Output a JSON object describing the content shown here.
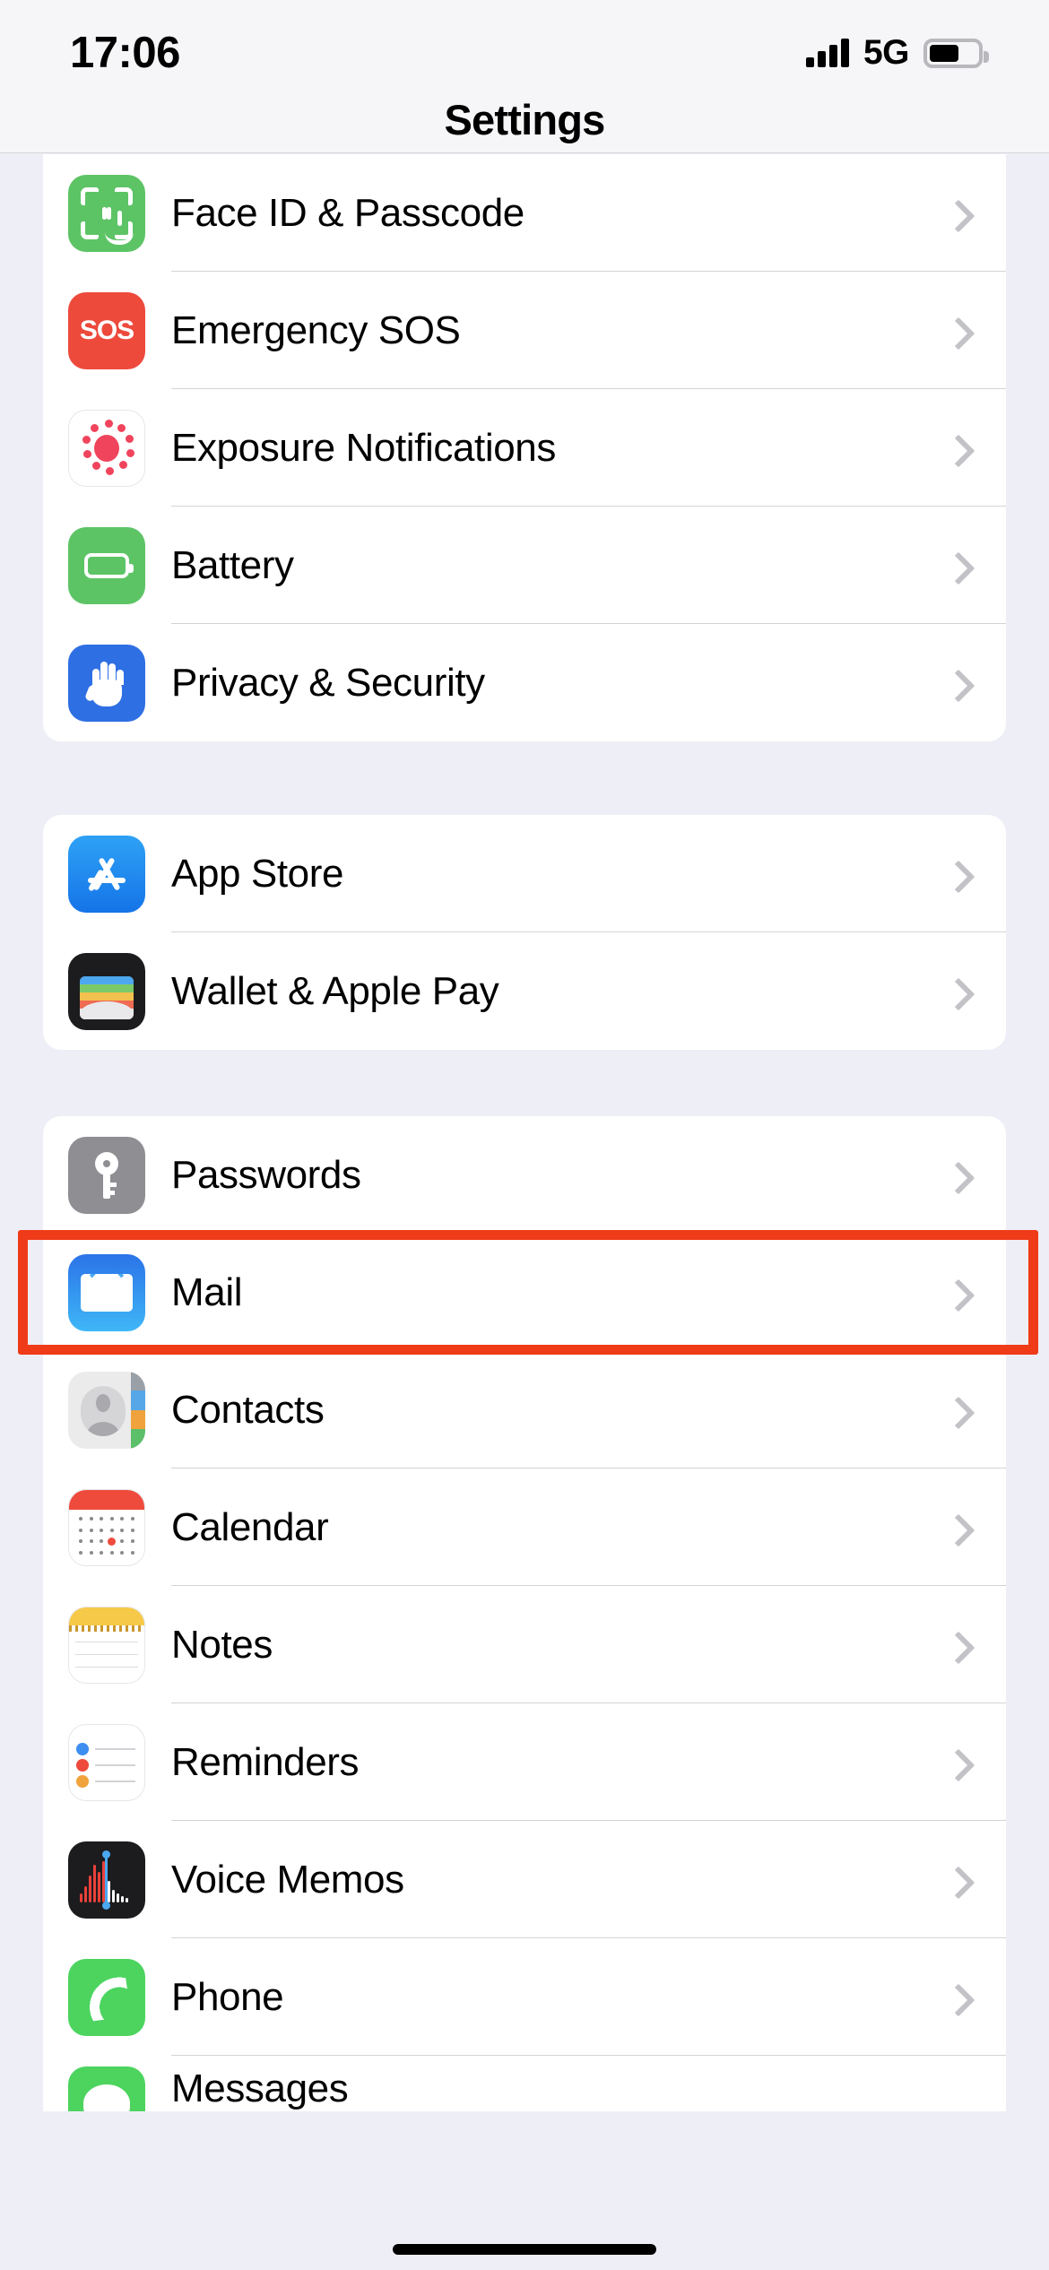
{
  "status_bar": {
    "time": "17:06",
    "network": "5G",
    "signal_icon": "signal-bars-icon",
    "battery_icon": "battery-icon",
    "battery_level_percent": 62
  },
  "nav": {
    "title": "Settings"
  },
  "theme": {
    "background": "#eeeef6",
    "card_background": "#ffffff",
    "separator": "#d4d4d8",
    "chevron": "#c2c2c7",
    "highlight": "#ef3b18",
    "label_text": "#000000"
  },
  "groups": [
    {
      "name": "security-group",
      "rows": [
        {
          "label": "Face ID & Passcode",
          "icon": "faceid-icon",
          "chevron": true
        },
        {
          "label": "Emergency SOS",
          "icon": "sos-icon",
          "chevron": true,
          "icon_text": "SOS"
        },
        {
          "label": "Exposure Notifications",
          "icon": "exposure-notifications-icon",
          "chevron": true
        },
        {
          "label": "Battery",
          "icon": "battery-icon",
          "chevron": true
        },
        {
          "label": "Privacy & Security",
          "icon": "hand-icon",
          "chevron": true
        }
      ]
    },
    {
      "name": "store-group",
      "rows": [
        {
          "label": "App Store",
          "icon": "app-store-icon",
          "chevron": true
        },
        {
          "label": "Wallet & Apple Pay",
          "icon": "wallet-icon",
          "chevron": true
        }
      ]
    },
    {
      "name": "apps-group",
      "rows": [
        {
          "label": "Passwords",
          "icon": "key-icon",
          "chevron": true
        },
        {
          "label": "Mail",
          "icon": "mail-icon",
          "chevron": true,
          "highlighted": true
        },
        {
          "label": "Contacts",
          "icon": "contacts-icon",
          "chevron": true
        },
        {
          "label": "Calendar",
          "icon": "calendar-icon",
          "chevron": true
        },
        {
          "label": "Notes",
          "icon": "notes-icon",
          "chevron": true
        },
        {
          "label": "Reminders",
          "icon": "reminders-icon",
          "chevron": true
        },
        {
          "label": "Voice Memos",
          "icon": "voice-memos-icon",
          "chevron": true
        },
        {
          "label": "Phone",
          "icon": "phone-icon",
          "chevron": true
        },
        {
          "label": "Messages",
          "icon": "messages-icon",
          "chevron": true,
          "partial": true
        }
      ]
    }
  ],
  "home_indicator": "home-indicator"
}
